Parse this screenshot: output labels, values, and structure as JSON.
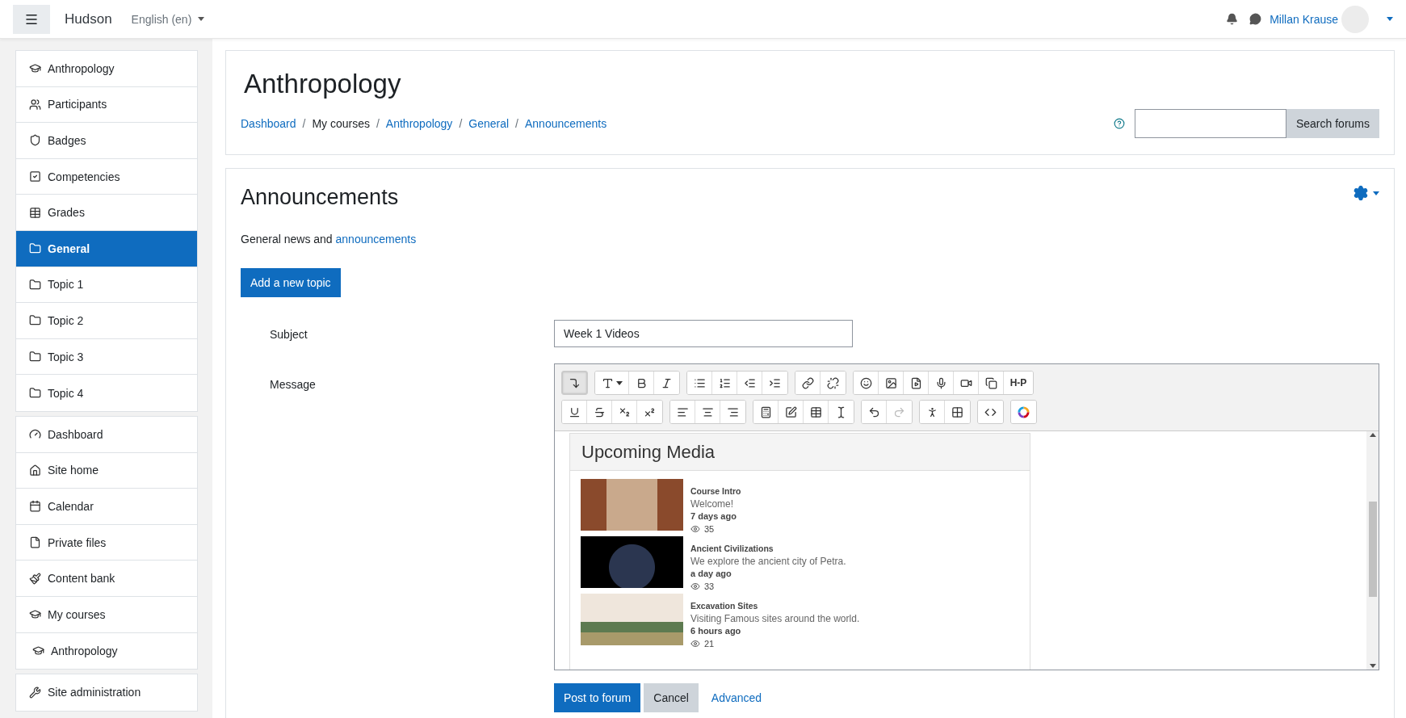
{
  "navbar": {
    "site_name": "Hudson",
    "language": "English (en)",
    "user_name": "Millan Krause"
  },
  "sidebar": {
    "groups": [
      [
        {
          "label": "Anthropology",
          "selected": false
        },
        {
          "label": "Participants",
          "selected": false
        },
        {
          "label": "Badges",
          "selected": false
        },
        {
          "label": "Competencies",
          "selected": false
        },
        {
          "label": "Grades",
          "selected": false
        },
        {
          "label": "General",
          "selected": true
        },
        {
          "label": "Topic 1",
          "selected": false
        },
        {
          "label": "Topic 2",
          "selected": false
        },
        {
          "label": "Topic 3",
          "selected": false
        },
        {
          "label": "Topic 4",
          "selected": false
        }
      ],
      [
        {
          "label": "Dashboard",
          "selected": false
        },
        {
          "label": "Site home",
          "selected": false
        },
        {
          "label": "Calendar",
          "selected": false
        },
        {
          "label": "Private files",
          "selected": false
        },
        {
          "label": "Content bank",
          "selected": false
        },
        {
          "label": "My courses",
          "selected": false,
          "children": [
            {
              "label": "Anthropology",
              "selected": false
            }
          ]
        }
      ],
      [
        {
          "label": "Site administration",
          "selected": false
        }
      ]
    ]
  },
  "header": {
    "title": "Anthropology",
    "breadcrumb": [
      {
        "label": "Dashboard",
        "link": true
      },
      {
        "label": "My courses",
        "link": false
      },
      {
        "label": "Anthropology",
        "link": true
      },
      {
        "label": "General",
        "link": true
      },
      {
        "label": "Announcements",
        "link": true
      }
    ],
    "separator": "/",
    "search_button": "Search forums"
  },
  "forum": {
    "title": "Announcements",
    "description": "General news and",
    "description_link": "announcements",
    "add_button": "Add a new topic",
    "subject_label": "Subject",
    "subject_value": "Week 1 Videos",
    "message_label": "Message",
    "toolbar": {
      "toggle_pressed": true,
      "redo_disabled": true,
      "h5p_label": "H-P"
    },
    "media": {
      "title": "Upcoming Media",
      "items": [
        {
          "title": "Course Intro",
          "description": "Welcome!",
          "time": "7 days ago",
          "views": "35"
        },
        {
          "title": "Ancient Civilizations",
          "description": "We explore the ancient city of Petra.",
          "time": "a day ago",
          "views": "33"
        },
        {
          "title": "Excavation Sites",
          "description": "Visiting Famous sites around the world.",
          "time": "6 hours ago",
          "views": "21"
        }
      ]
    },
    "post_button": "Post to forum",
    "cancel_button": "Cancel",
    "advanced_link": "Advanced"
  }
}
